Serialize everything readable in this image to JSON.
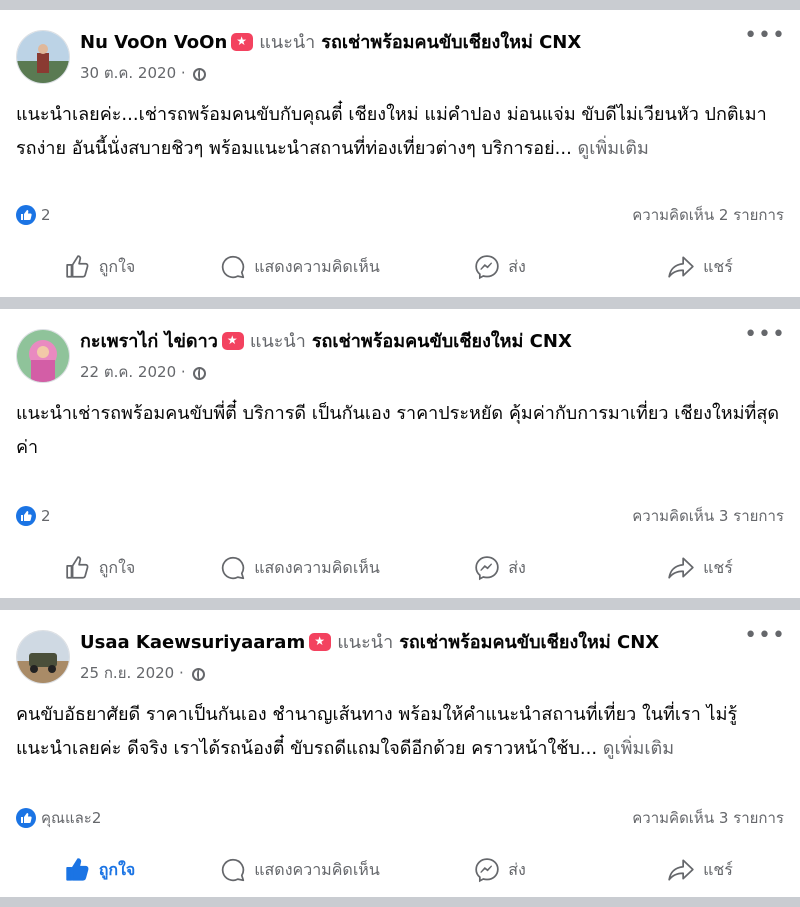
{
  "posts": [
    {
      "author": "Nu VoOn VoOn",
      "recommends": "แนะนำ",
      "page": "รถเช่าพร้อมคนขับเชียงใหม่ CNX",
      "date": "30 ต.ค. 2020 ·",
      "text": "แนะนำเลยค่ะ...เช่ารถพร้อมคนขับกับคุณตี๋ เชียงใหม่ แม่คำปอง ม่อนแจ่ม ขับดีไม่เวียนหัว ปกติเมารถง่าย อันนี้นั่งสบายชิวๆ พร้อมแนะนำสถานที่ท่องเที่ยวต่างๆ บริการอย่...",
      "see_more": "ดูเพิ่มเติม",
      "reaction_count": "2",
      "comments": "ความคิดเห็น 2 รายการ",
      "actions": {
        "like": "ถูกใจ",
        "comment": "แสดงความคิดเห็น",
        "send": "ส่ง",
        "share": "แชร์"
      }
    },
    {
      "author": "กะเพราไก่ ไข่ดาว",
      "recommends": "แนะนำ",
      "page": "รถเช่าพร้อมคนขับเชียงใหม่ CNX",
      "date": "22 ต.ค. 2020 ·",
      "text": "แนะนำเช่ารถพร้อมคนขับพี่ตี๋ บริการดี เป็นกันเอง ราคาประหยัด คุ้มค่ากับการมาเที่ยว เชียงใหม่ที่สุดค่า",
      "see_more": "",
      "reaction_count": "2",
      "comments": "ความคิดเห็น 3 รายการ",
      "actions": {
        "like": "ถูกใจ",
        "comment": "แสดงความคิดเห็น",
        "send": "ส่ง",
        "share": "แชร์"
      }
    },
    {
      "author": "Usaa Kaewsuriyaaram",
      "recommends": "แนะนำ",
      "page": "รถเช่าพร้อมคนขับเชียงใหม่ CNX",
      "date": "25 ก.ย. 2020 ·",
      "text": "คนขับอัธยาศัยดี ราคาเป็นกันเอง ชำนาญเส้นทาง พร้อมให้คำแนะนำสถานที่เที่ยว ในที่เรา ไม่รู้ แนะนำเลยค่ะ ดีจริง เราได้รถน้องตี๋ ขับรถดีแถมใจดีอีกด้วย คราวหน้าใช้บ...",
      "see_more": "ดูเพิ่มเติม",
      "reaction_count": "คุณและ2",
      "comments": "ความคิดเห็น 3 รายการ",
      "actions": {
        "like": "ถูกใจ",
        "comment": "แสดงความคิดเห็น",
        "send": "ส่ง",
        "share": "แชร์"
      }
    }
  ],
  "colors": {
    "accent": "#1b74e4",
    "recommend_badge": "#f3425f",
    "secondary_text": "#65676b"
  },
  "icons": [
    "recommend-badge-icon",
    "globe-icon",
    "more-icon",
    "like-reaction-icon",
    "thumbs-up-icon",
    "comment-icon",
    "messenger-icon",
    "share-icon"
  ]
}
